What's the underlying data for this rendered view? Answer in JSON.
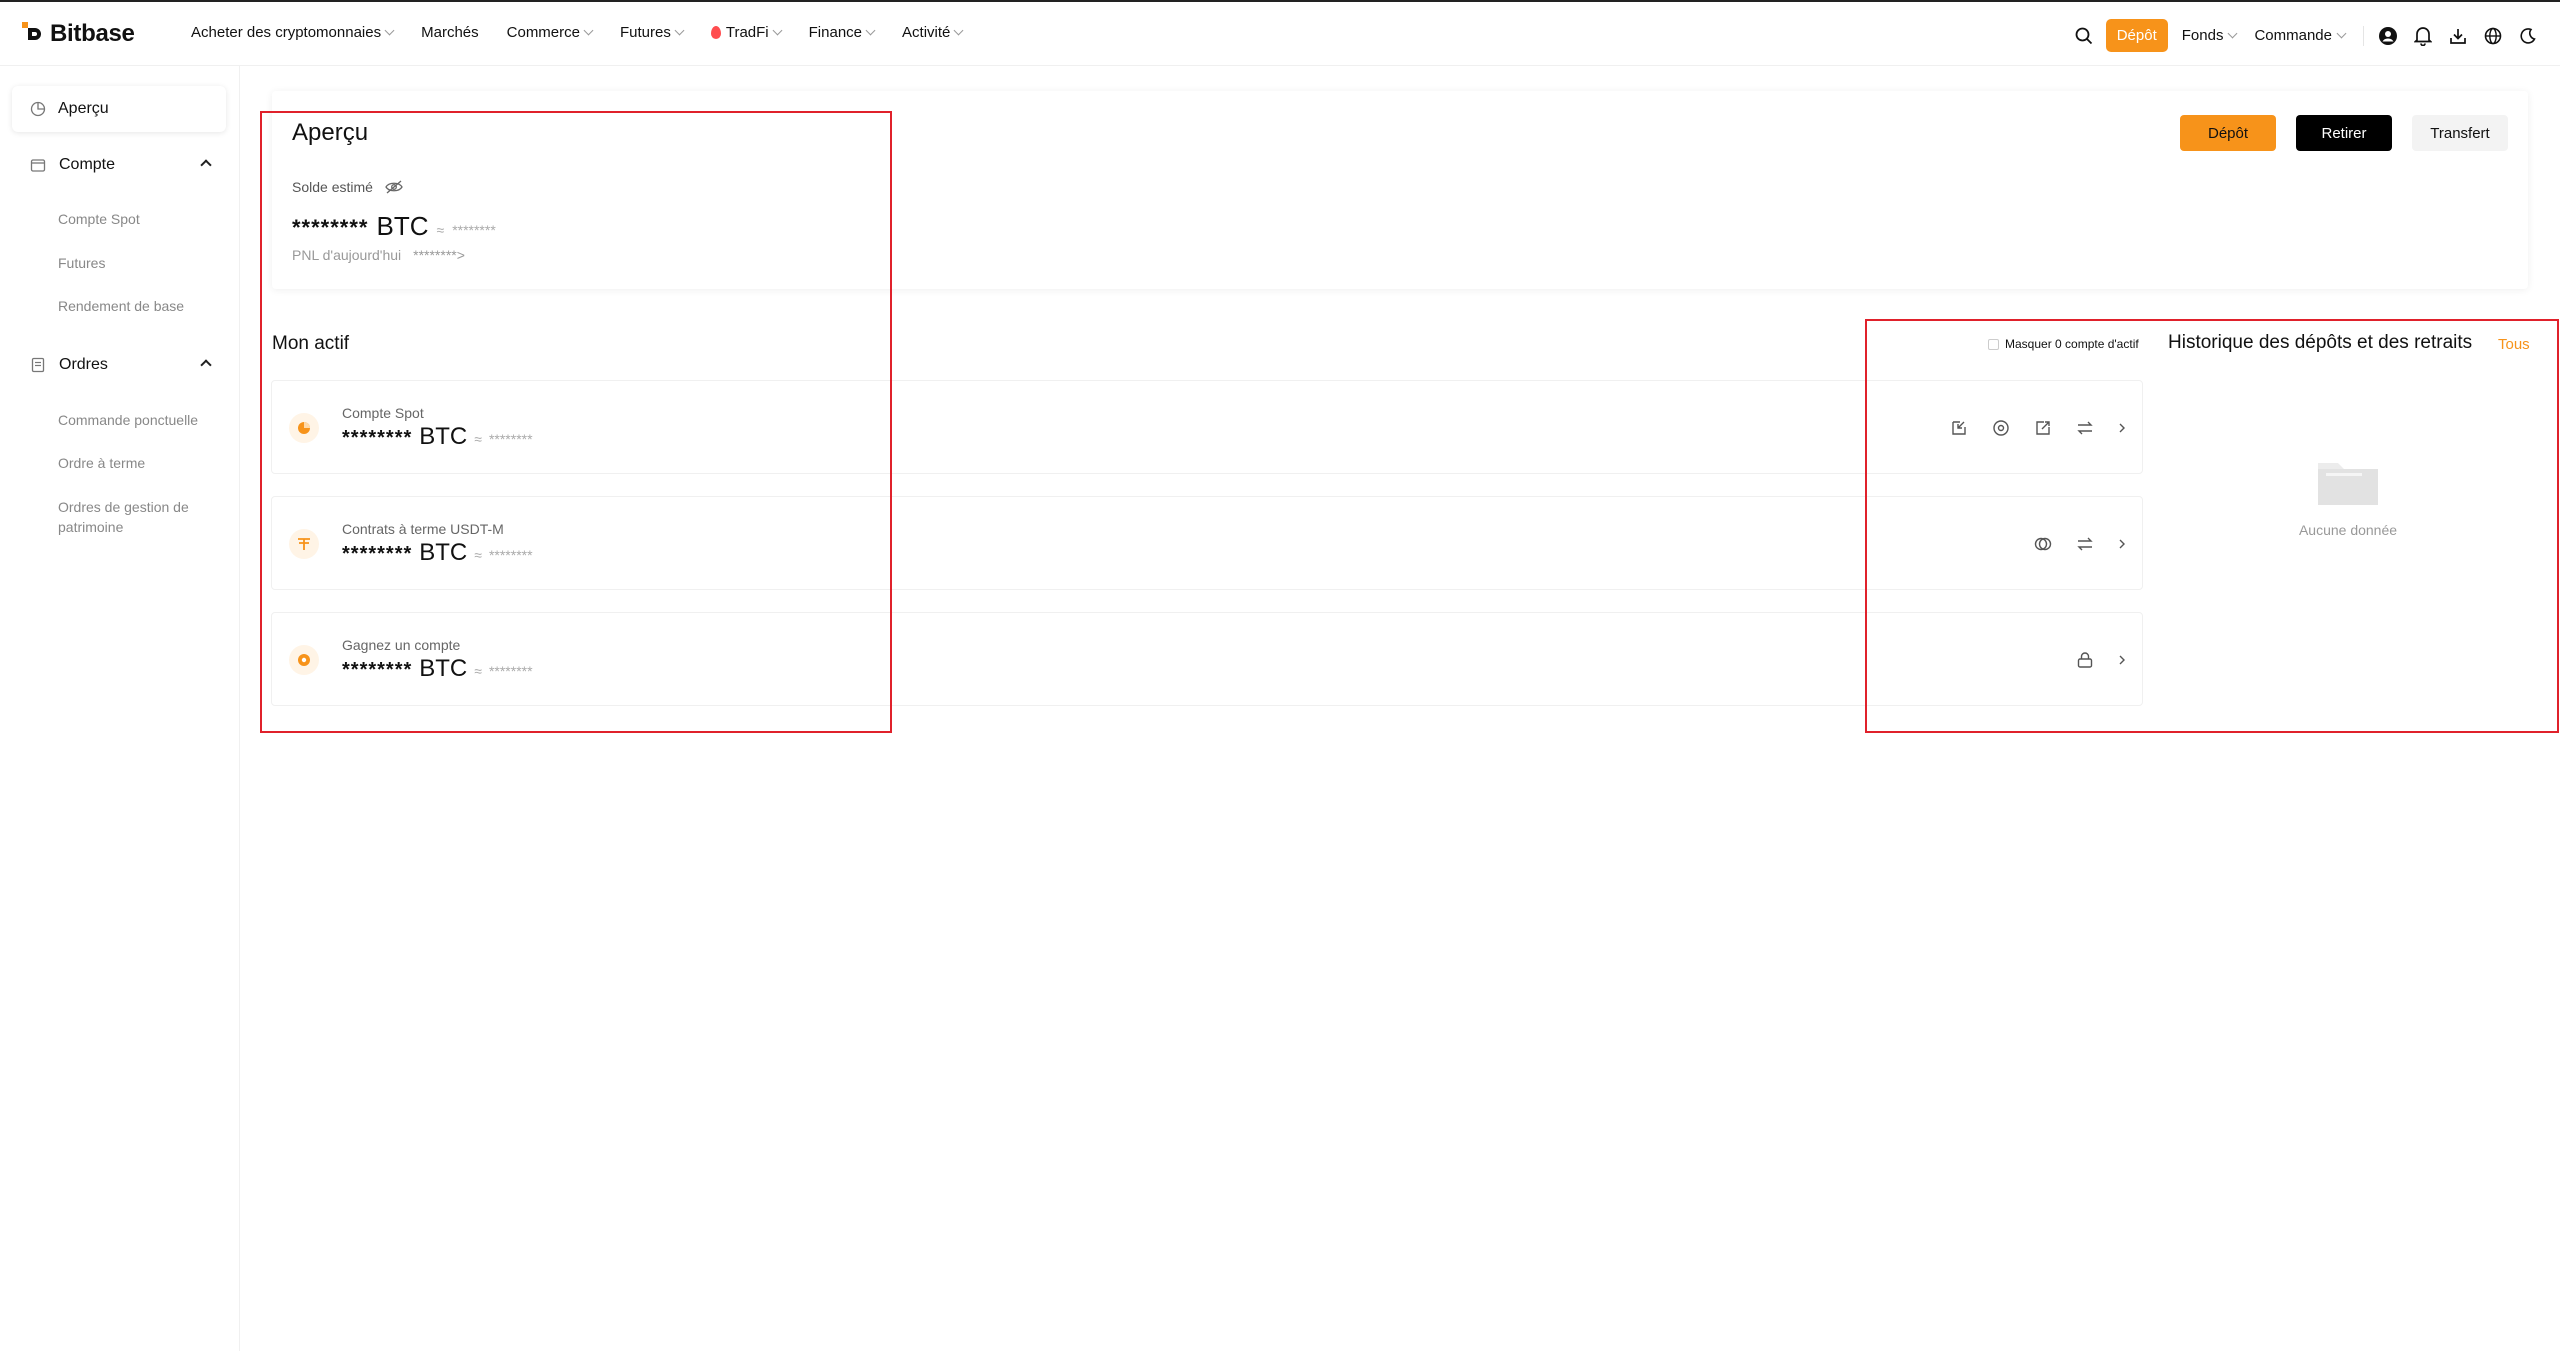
{
  "brand": {
    "name": "Bitbase",
    "accent": "#f7931a"
  },
  "nav": {
    "items": [
      {
        "label": "Acheter des cryptomonnaies",
        "dropdown": true
      },
      {
        "label": "Marchés",
        "dropdown": false
      },
      {
        "label": "Commerce",
        "dropdown": true
      },
      {
        "label": "Futures",
        "dropdown": true
      },
      {
        "label": "TradFi",
        "dropdown": true
      },
      {
        "label": "Finance",
        "dropdown": true
      },
      {
        "label": "Activité",
        "dropdown": true
      }
    ]
  },
  "topright": {
    "depot": "Dépôt",
    "fonds": "Fonds",
    "commande": "Commande",
    "icons": [
      "search-icon",
      "user-icon",
      "bell-icon",
      "download-icon",
      "globe-icon",
      "moon-icon"
    ]
  },
  "sidebar": {
    "active": "Aperçu",
    "groups": [
      {
        "label": "Compte",
        "items": [
          "Compte Spot",
          "Futures",
          "Rendement de base"
        ]
      },
      {
        "label": "Ordres",
        "items": [
          "Commande ponctuelle",
          "Ordre à terme",
          "Ordres de gestion de patrimoine"
        ]
      }
    ]
  },
  "overview": {
    "title": "Aperçu",
    "balance_label": "Solde estimé",
    "masked": "********",
    "currency": "BTC",
    "approx": "≈",
    "pnl_label": "PNL d'aujourd'hui",
    "pnl_value": "********>",
    "buttons": {
      "depot": "Dépôt",
      "retirer": "Retirer",
      "transfert": "Transfert"
    }
  },
  "assets": {
    "title": "Mon actif",
    "hide_zero": "Masquer 0 compte d'actif",
    "accounts": [
      {
        "name": "Compte Spot",
        "masked": "********",
        "currency": "BTC"
      },
      {
        "name": "Contrats à terme USDT-M",
        "masked": "********",
        "currency": "BTC"
      },
      {
        "name": "Gagnez un compte",
        "masked": "********",
        "currency": "BTC"
      }
    ]
  },
  "history": {
    "title": "Historique des dépôts et des retraits",
    "all": "Tous",
    "empty": "Aucune donnée"
  }
}
